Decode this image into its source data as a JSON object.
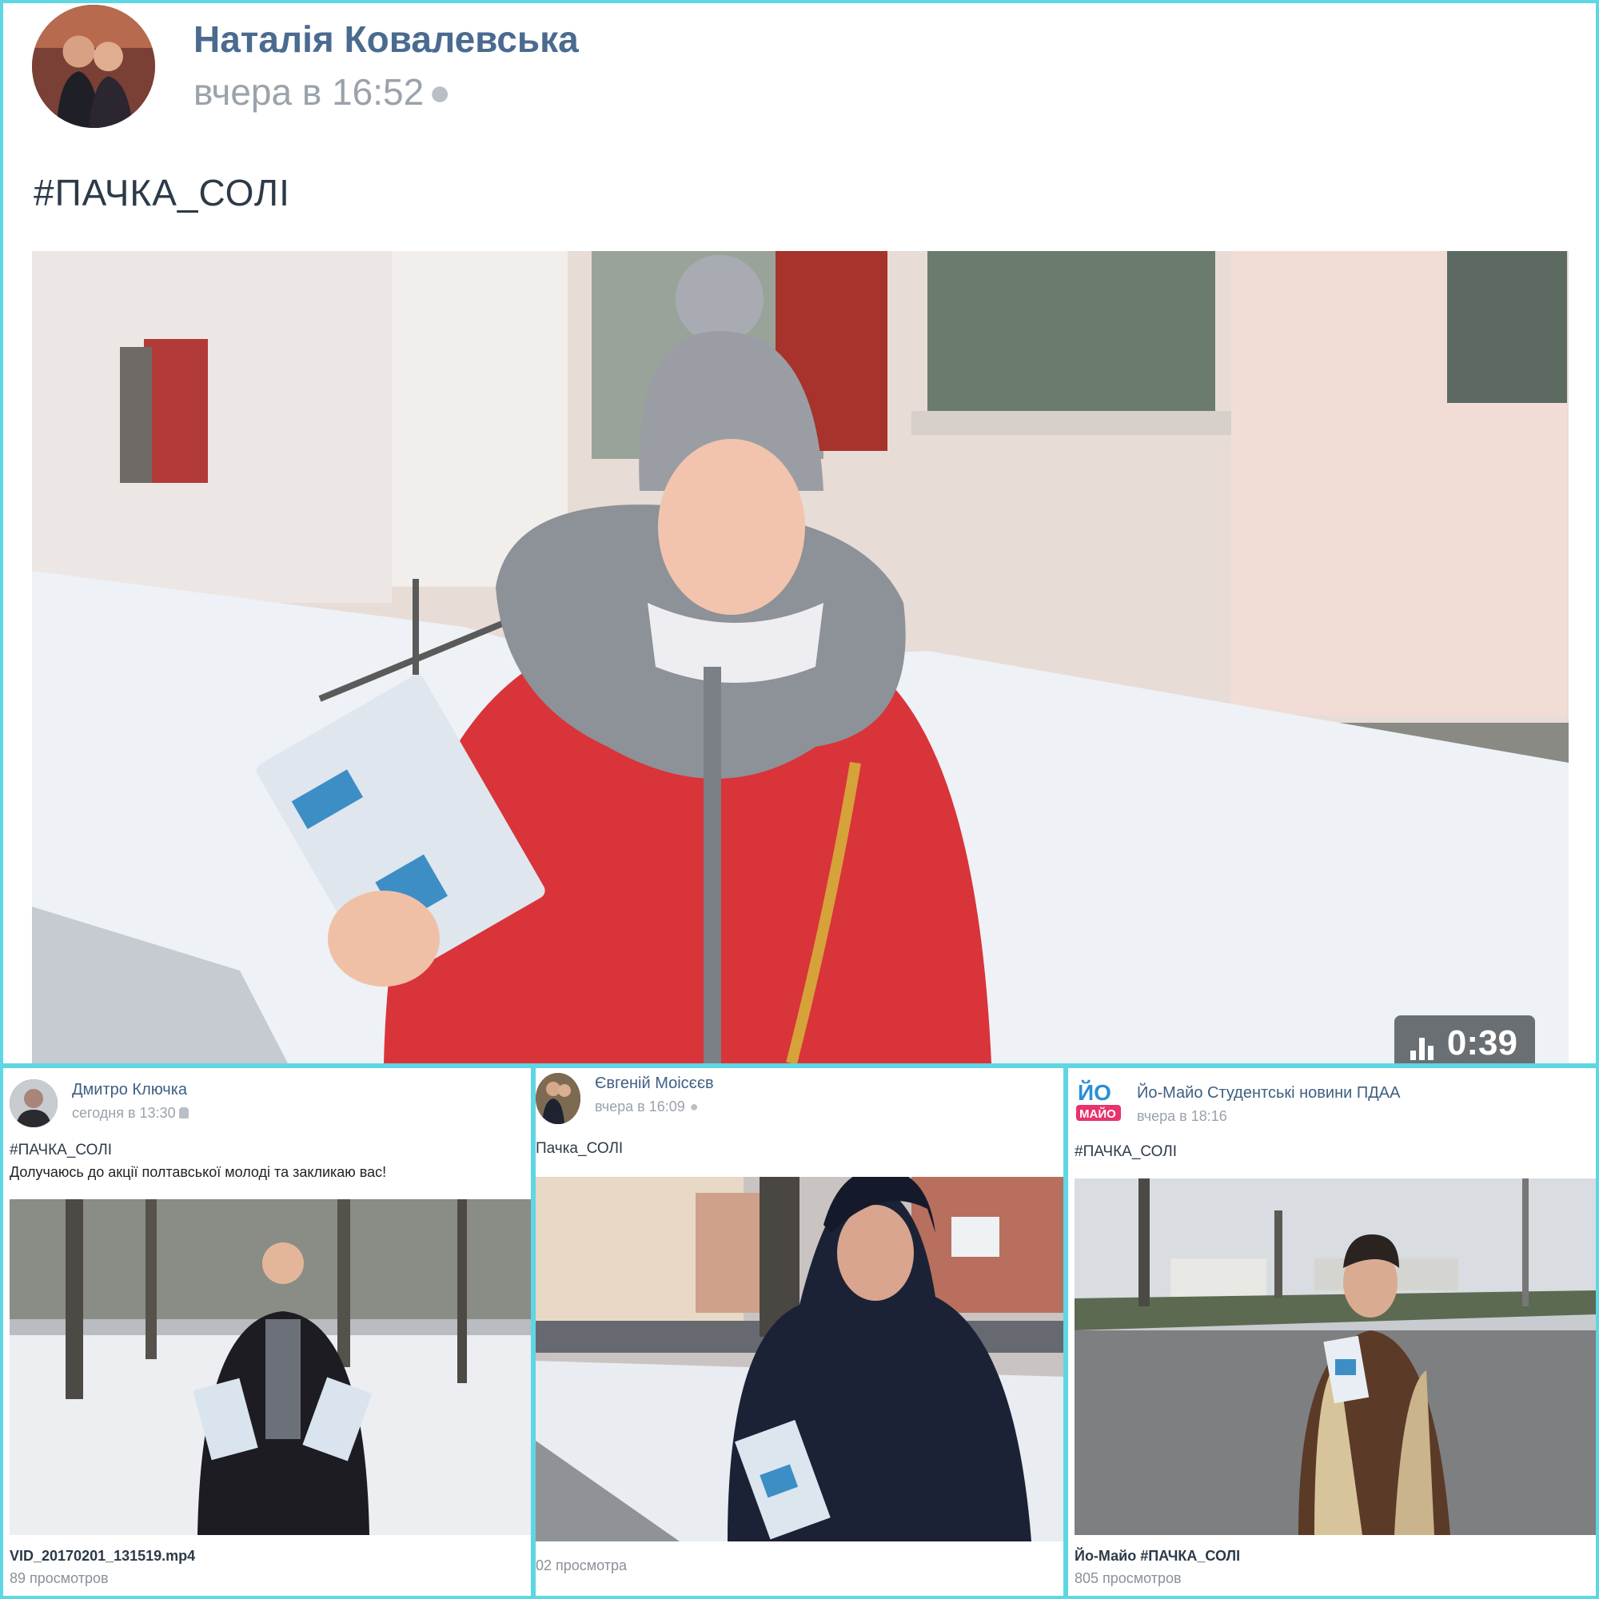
{
  "main": {
    "author": "Наталія Ковалевська",
    "time": "вчера в 16:52",
    "time_icon": "apple-icon",
    "hashtag": "#ПАЧКА_СОЛІ",
    "video": {
      "duration": "0:39"
    }
  },
  "posts": [
    {
      "author": "Дмитро Ключка",
      "time": "сегодня в 13:30",
      "time_icon": "android-icon",
      "hashtag": "#ПАЧКА_СОЛІ",
      "text": "Долучаюсь до акції полтавської молоді та закликаю вас!",
      "video_title": "VID_20170201_131519.mp4",
      "views": "89 просмотров"
    },
    {
      "author": "Євгеній Моісєєв",
      "time": "вчера в 16:09",
      "time_icon": "apple-icon",
      "hashtag": "Пачка_СОЛІ",
      "video_title": "",
      "views": "02 просмотра"
    },
    {
      "author": "Йо-Майо Студентські новини ПДАА",
      "time": "вчера в 18:16",
      "hashtag": "#ПАЧКА_СОЛІ",
      "logo_text": "ЙО МАЙО",
      "video_title": "Йо-Майо #ПАЧКА_СОЛІ",
      "views": "805 просмотров"
    }
  ]
}
